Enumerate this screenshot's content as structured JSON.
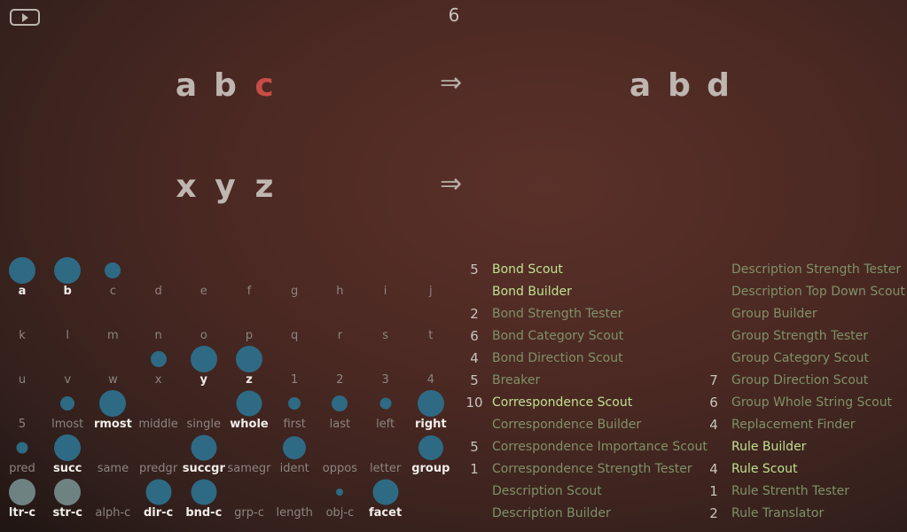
{
  "controls": {
    "play_icon": "play-icon",
    "step_count": "6"
  },
  "problem": {
    "initial": [
      "a",
      "b",
      "c"
    ],
    "modified": [
      "a",
      "b",
      "d"
    ],
    "target": [
      "x",
      "y",
      "z"
    ],
    "arrow": "⇒",
    "highlight_color": "#c94b45"
  },
  "slipnet": {
    "active_color": "#2e6a84",
    "clamped_color": "#6f8282",
    "nodes": [
      {
        "label": "a",
        "activation": 100,
        "on": true
      },
      {
        "label": "b",
        "activation": 100,
        "on": true
      },
      {
        "label": "c",
        "activation": 35
      },
      {
        "label": "d",
        "activation": 0
      },
      {
        "label": "e",
        "activation": 0
      },
      {
        "label": "f",
        "activation": 0
      },
      {
        "label": "g",
        "activation": 0
      },
      {
        "label": "h",
        "activation": 0
      },
      {
        "label": "i",
        "activation": 0
      },
      {
        "label": "j",
        "activation": 0
      },
      {
        "label": "k",
        "activation": 0
      },
      {
        "label": "l",
        "activation": 0
      },
      {
        "label": "m",
        "activation": 0
      },
      {
        "label": "n",
        "activation": 0
      },
      {
        "label": "o",
        "activation": 0
      },
      {
        "label": "p",
        "activation": 0
      },
      {
        "label": "q",
        "activation": 0
      },
      {
        "label": "r",
        "activation": 0
      },
      {
        "label": "s",
        "activation": 0
      },
      {
        "label": "t",
        "activation": 0
      },
      {
        "label": "u",
        "activation": 0
      },
      {
        "label": "v",
        "activation": 0
      },
      {
        "label": "w",
        "activation": 0
      },
      {
        "label": "x",
        "activation": 35
      },
      {
        "label": "y",
        "activation": 100,
        "on": true
      },
      {
        "label": "z",
        "activation": 100,
        "on": true
      },
      {
        "label": "1",
        "activation": 0
      },
      {
        "label": "2",
        "activation": 0
      },
      {
        "label": "3",
        "activation": 0
      },
      {
        "label": "4",
        "activation": 0
      },
      {
        "label": "5",
        "activation": 0
      },
      {
        "label": "lmost",
        "activation": 30
      },
      {
        "label": "rmost",
        "activation": 100,
        "on": true
      },
      {
        "label": "middle",
        "activation": 0
      },
      {
        "label": "single",
        "activation": 0
      },
      {
        "label": "whole",
        "activation": 92,
        "on": true
      },
      {
        "label": "first",
        "activation": 22
      },
      {
        "label": "last",
        "activation": 35
      },
      {
        "label": "left",
        "activation": 20
      },
      {
        "label": "right",
        "activation": 100,
        "on": true
      },
      {
        "label": "pred",
        "activation": 18
      },
      {
        "label": "succ",
        "activation": 100,
        "on": true
      },
      {
        "label": "same",
        "activation": 0
      },
      {
        "label": "predgr",
        "activation": 0
      },
      {
        "label": "succgr",
        "activation": 95,
        "on": true
      },
      {
        "label": "samegr",
        "activation": 0
      },
      {
        "label": "ident",
        "activation": 78
      },
      {
        "label": "oppos",
        "activation": 0
      },
      {
        "label": "letter",
        "activation": 0
      },
      {
        "label": "group",
        "activation": 90,
        "on": true
      },
      {
        "label": "ltr-c",
        "activation": 100,
        "on": true,
        "clamped": true
      },
      {
        "label": "str-c",
        "activation": 100,
        "on": true,
        "clamped": true
      },
      {
        "label": "alph-c",
        "activation": 0
      },
      {
        "label": "dir-c",
        "activation": 95,
        "on": true
      },
      {
        "label": "bnd-c",
        "activation": 95,
        "on": true
      },
      {
        "label": "grp-c",
        "activation": 0
      },
      {
        "label": "length",
        "activation": 0
      },
      {
        "label": "obj-c",
        "activation": 8
      },
      {
        "label": "facet",
        "activation": 95,
        "on": true
      }
    ]
  },
  "coderack": {
    "columns": [
      [
        {
          "count": "5",
          "name": "Bond Scout",
          "on": true
        },
        {
          "count": "",
          "name": "Bond Builder",
          "on": true
        },
        {
          "count": "2",
          "name": "Bond Strength Tester"
        },
        {
          "count": "6",
          "name": "Bond Category Scout"
        },
        {
          "count": "4",
          "name": "Bond Direction Scout"
        },
        {
          "count": "5",
          "name": "Breaker"
        },
        {
          "count": "10",
          "name": "Correspondence Scout",
          "on": true
        },
        {
          "count": "",
          "name": "Correspondence Builder"
        },
        {
          "count": "5",
          "name": "Correspondence Importance Scout"
        },
        {
          "count": "1",
          "name": "Correspondence Strength Tester"
        },
        {
          "count": "",
          "name": "Description Scout"
        },
        {
          "count": "",
          "name": "Description Builder"
        }
      ],
      [
        {
          "count": "",
          "name": "Description Strength Tester"
        },
        {
          "count": "",
          "name": "Description Top Down Scout"
        },
        {
          "count": "",
          "name": "Group Builder"
        },
        {
          "count": "",
          "name": "Group Strength Tester"
        },
        {
          "count": "",
          "name": "Group Category Scout"
        },
        {
          "count": "7",
          "name": "Group Direction Scout"
        },
        {
          "count": "6",
          "name": "Group Whole String Scout"
        },
        {
          "count": "4",
          "name": "Replacement Finder"
        },
        {
          "count": "",
          "name": "Rule Builder",
          "on": true
        },
        {
          "count": "4",
          "name": "Rule Scout",
          "on": true
        },
        {
          "count": "1",
          "name": "Rule Strenth Tester"
        },
        {
          "count": "2",
          "name": "Rule Translator"
        }
      ]
    ]
  }
}
